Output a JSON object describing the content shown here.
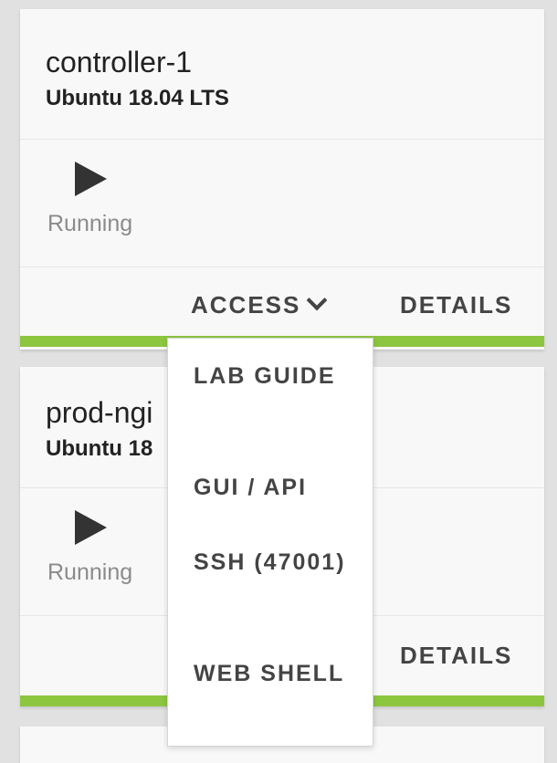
{
  "cards": [
    {
      "name": "controller-1",
      "os": "Ubuntu 18.04 LTS",
      "status": "Running",
      "access_label": "ACCESS",
      "details_label": "DETAILS"
    },
    {
      "name": "prod-ngi",
      "os": "Ubuntu 18",
      "status": "Running",
      "details_label": "DETAILS"
    }
  ],
  "access_menu": {
    "items": [
      {
        "label": "LAB GUIDE"
      },
      {
        "label": "GUI / API"
      },
      {
        "label": "SSH (47001)"
      },
      {
        "label": "WEB SHELL"
      }
    ]
  },
  "colors": {
    "accent_green": "#8cc63f",
    "status_gray": "#8b8b8b"
  }
}
